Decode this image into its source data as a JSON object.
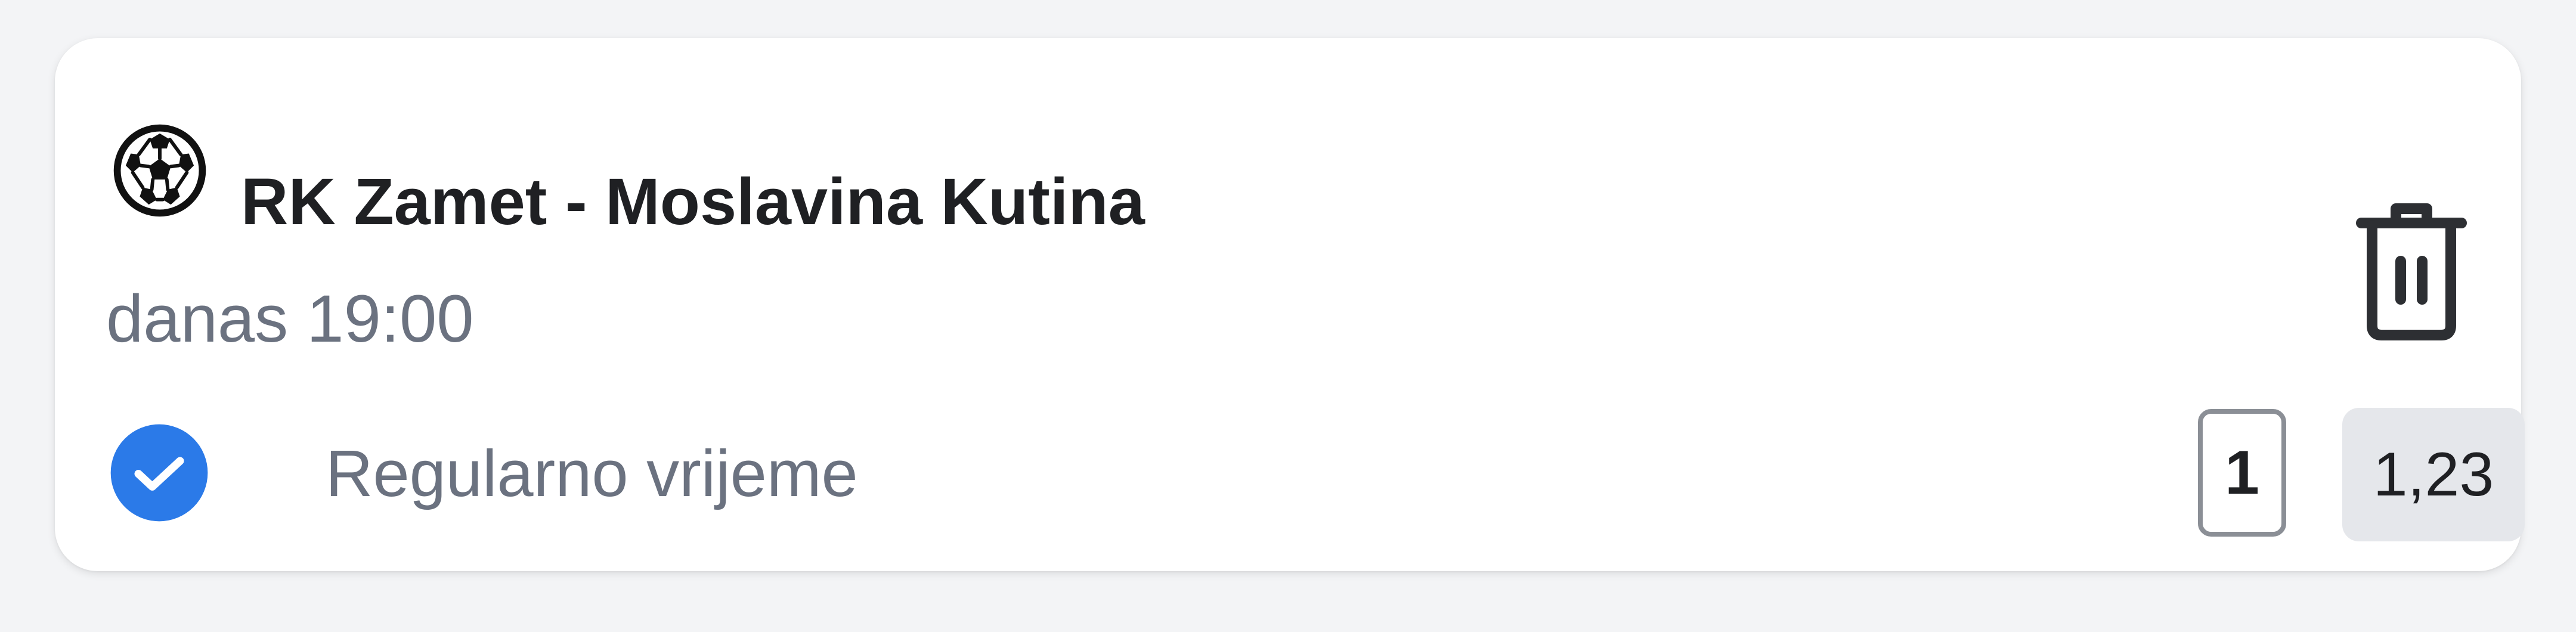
{
  "ticket": {
    "match_title": "RK Zamet - Moslavina Kutina",
    "match_time": "danas 19:00",
    "market_label": "Regularno vrijeme",
    "outcome": "1",
    "odds": "1,23",
    "sport_icon": "handball-ball-icon",
    "delete_icon": "trash-icon",
    "status_icon": "check-circle-icon"
  },
  "colors": {
    "background": "#f3f4f6",
    "card": "#ffffff",
    "accent": "#2b7ae8",
    "text_primary": "#1f2023",
    "text_secondary": "#6b7280",
    "odds_bg": "#e5e7eb"
  }
}
